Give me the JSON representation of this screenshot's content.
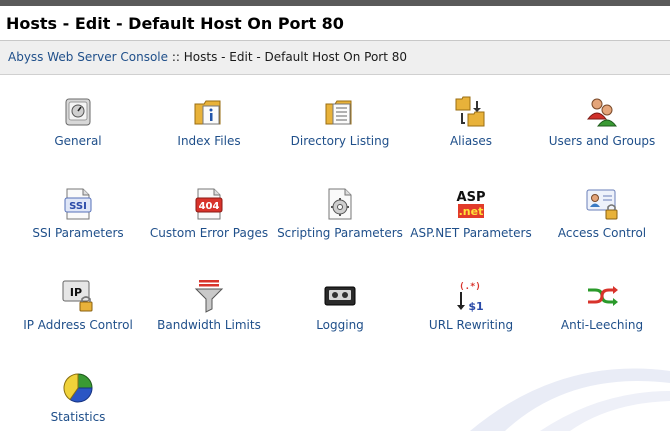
{
  "title": "Hosts - Edit - Default Host On Port 80",
  "breadcrumb": {
    "root": "Abyss Web Server Console",
    "separator": " :: ",
    "current": "Hosts - Edit - Default Host On Port 80"
  },
  "items": [
    {
      "label": "General",
      "icon": "general-icon"
    },
    {
      "label": "Index Files",
      "icon": "index-files-icon"
    },
    {
      "label": "Directory Listing",
      "icon": "directory-listing-icon"
    },
    {
      "label": "Aliases",
      "icon": "aliases-icon"
    },
    {
      "label": "Users and Groups",
      "icon": "users-groups-icon"
    },
    {
      "label": "SSI Parameters",
      "icon": "ssi-icon"
    },
    {
      "label": "Custom Error Pages",
      "icon": "error-404-icon"
    },
    {
      "label": "Scripting Parameters",
      "icon": "scripting-icon"
    },
    {
      "label": "ASP.NET Parameters",
      "icon": "aspnet-icon"
    },
    {
      "label": "Access Control",
      "icon": "access-control-icon"
    },
    {
      "label": "IP Address Control",
      "icon": "ip-control-icon"
    },
    {
      "label": "Bandwidth Limits",
      "icon": "bandwidth-funnel-icon"
    },
    {
      "label": "Logging",
      "icon": "cassette-icon"
    },
    {
      "label": "URL Rewriting",
      "icon": "url-rewriting-icon"
    },
    {
      "label": "Anti-Leeching",
      "icon": "anti-leeching-icon"
    },
    {
      "label": "Statistics",
      "icon": "pie-chart-icon"
    }
  ],
  "icon_text": {
    "ssi": "SSI",
    "error": "404",
    "asp": "ASP",
    "net": ".net",
    "ip": "IP",
    "regex": "(.*)",
    "dollar": "$1"
  },
  "colors": {
    "link": "#1f4f8a",
    "crumb_bg": "#efefef"
  }
}
